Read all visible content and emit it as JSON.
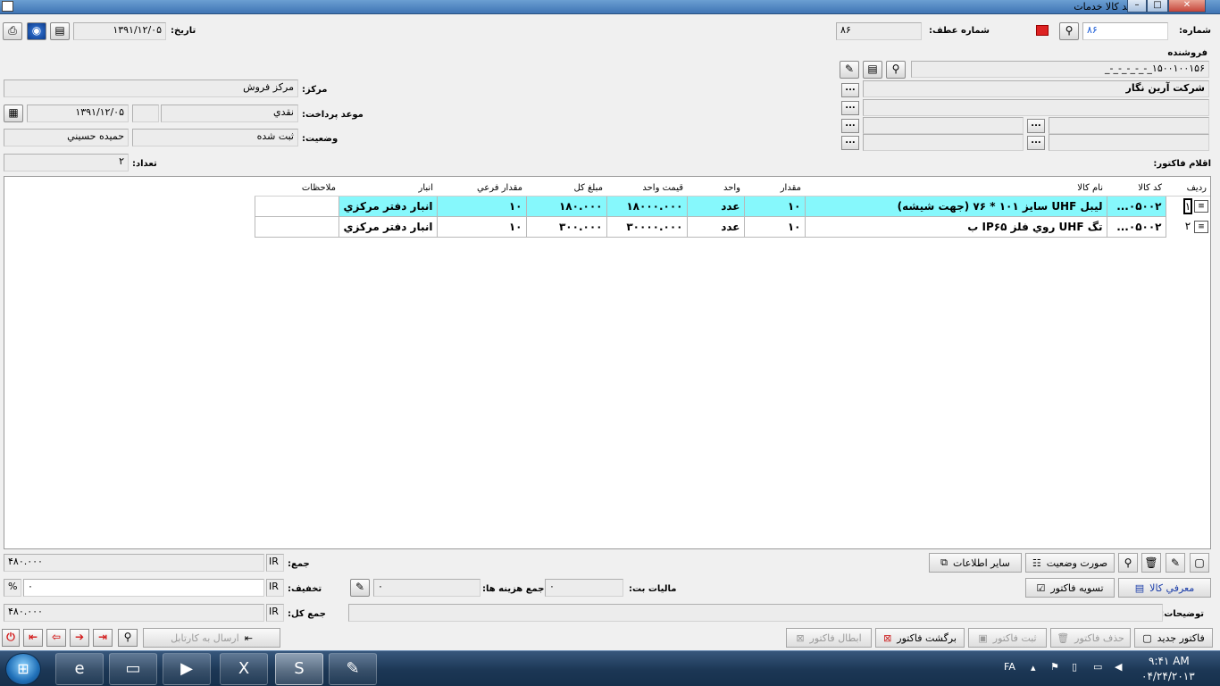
{
  "window": {
    "title": "خريد كالا خدمات"
  },
  "header": {
    "number_label": "شماره:",
    "number_value": "۸۶",
    "ref_number_label": "شماره عطف:",
    "ref_number_value": "۸۶",
    "date_label": "تاريخ:",
    "date_value": "۱۳۹۱/۱۲/۰۵"
  },
  "seller": {
    "label": "فروشنده",
    "code": "۱۵۰۰۱۰۰۱۵۶_-_-_-_-_-_",
    "name": "شركت آرين نگار"
  },
  "info": {
    "center_label": "مركز:",
    "center_value": "مركز فروش",
    "payment_label": "موعد پرداخت:",
    "payment_value": "نقدي",
    "payment_date": "۱۳۹۱/۱۲/۰۵",
    "status_label": "وضعيت:",
    "status_value": "ثبت شده",
    "status_user": "حميده حسيني",
    "count_label": "تعداد:",
    "count_value": "۲",
    "items_label": "اقلام فاكتور:"
  },
  "grid": {
    "columns": [
      "رديف",
      "كد كالا",
      "نام كالا",
      "مقدار",
      "واحد",
      "قيمت واحد",
      "مبلغ كل",
      "مقدار فرعي",
      "انبار",
      "ملاحظات"
    ],
    "rows": [
      {
        "row": "۱",
        "code": "۰۵۰۰۲...",
        "name": "ليبل UHF سايز ۱۰۱ * ۷۶ (جهت شيشه)",
        "qty": "۱۰",
        "unit": "عدد",
        "unit_price": "۱۸۰۰۰.۰۰۰",
        "total": "۱۸۰.۰۰۰",
        "sub_qty": "۱۰",
        "warehouse": "انبار دفتر مركزي",
        "notes": ""
      },
      {
        "row": "۲",
        "code": "۰۵۰۰۲...",
        "name": "تگ UHF روي فلز IP۶۵ ب",
        "qty": "۱۰",
        "unit": "عدد",
        "unit_price": "۳۰۰۰۰.۰۰۰",
        "total": "۳۰۰.۰۰۰",
        "sub_qty": "۱۰",
        "warehouse": "انبار دفتر مركزي",
        "notes": ""
      }
    ]
  },
  "totals": {
    "sum_label": "جمع:",
    "sum_value": "۴۸۰.۰۰۰",
    "currency": "IR",
    "discount_label": "تخفيف:",
    "discount_value": "۰",
    "percent": "%",
    "grand_label": "جمع كل:",
    "grand_value": "۴۸۰.۰۰۰",
    "expenses_label": "جمع هزينه ها:",
    "expenses_value": "۰",
    "vat_label": "ماليات بت:",
    "vat_value": "۰",
    "desc_label": "توضيحات:"
  },
  "buttons": {
    "other_info": "ساير اطلاعات",
    "status_image": "صورت وضعيت",
    "settle": "تسويه فاكتور",
    "introduce_goods": "معرفي كالا",
    "new_invoice": "فاكتور جديد",
    "delete_invoice": "حذف فاكتور",
    "save_invoice": "ثبت فاكتور",
    "return_invoice": "برگشت فاكتور",
    "cancel_invoice": "ابطال فاكتور",
    "send_kardex": "ارسال به كارتابل"
  },
  "taskbar": {
    "lang": "FA",
    "time": "۹:۴۱ AM",
    "date": "۰۴/۲۴/۲۰۱۳"
  }
}
